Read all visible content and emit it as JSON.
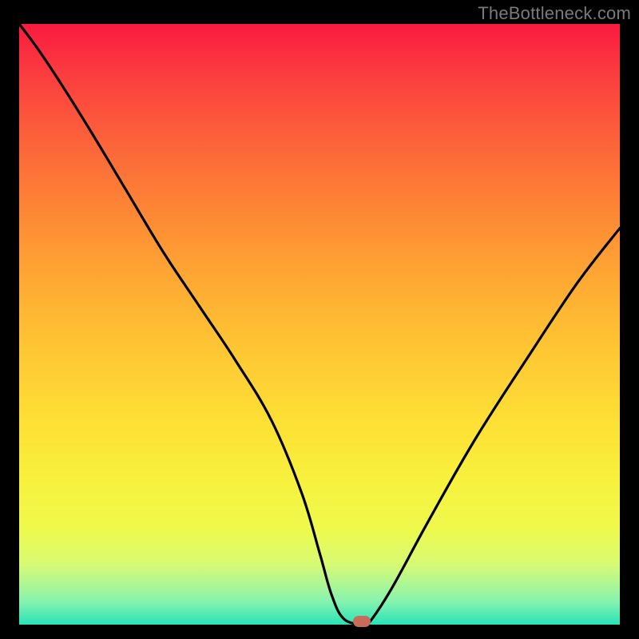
{
  "watermark": "TheBottleneck.com",
  "chart_data": {
    "type": "line",
    "title": "",
    "xlabel": "",
    "ylabel": "",
    "xlim": [
      0,
      100
    ],
    "ylim": [
      0,
      100
    ],
    "x": [
      0,
      3,
      7,
      12,
      18,
      24,
      30,
      36,
      42,
      47,
      50,
      52,
      54,
      57,
      58,
      62,
      68,
      76,
      85,
      93,
      100
    ],
    "values": [
      100,
      96,
      90,
      82,
      72,
      62,
      53,
      44,
      34,
      22,
      12,
      5,
      1,
      0,
      0,
      6,
      17,
      31,
      45,
      57,
      66
    ],
    "marker": {
      "x": 57,
      "y": 0.5
    },
    "background": {
      "kind": "vertical-gradient",
      "stops": [
        {
          "pos": 0,
          "color": "#fa1a3f"
        },
        {
          "pos": 0.2,
          "color": "#fc5e3b"
        },
        {
          "pos": 0.5,
          "color": "#fec633"
        },
        {
          "pos": 0.8,
          "color": "#eef94c"
        },
        {
          "pos": 1.0,
          "color": "#28e3b8"
        }
      ]
    }
  }
}
